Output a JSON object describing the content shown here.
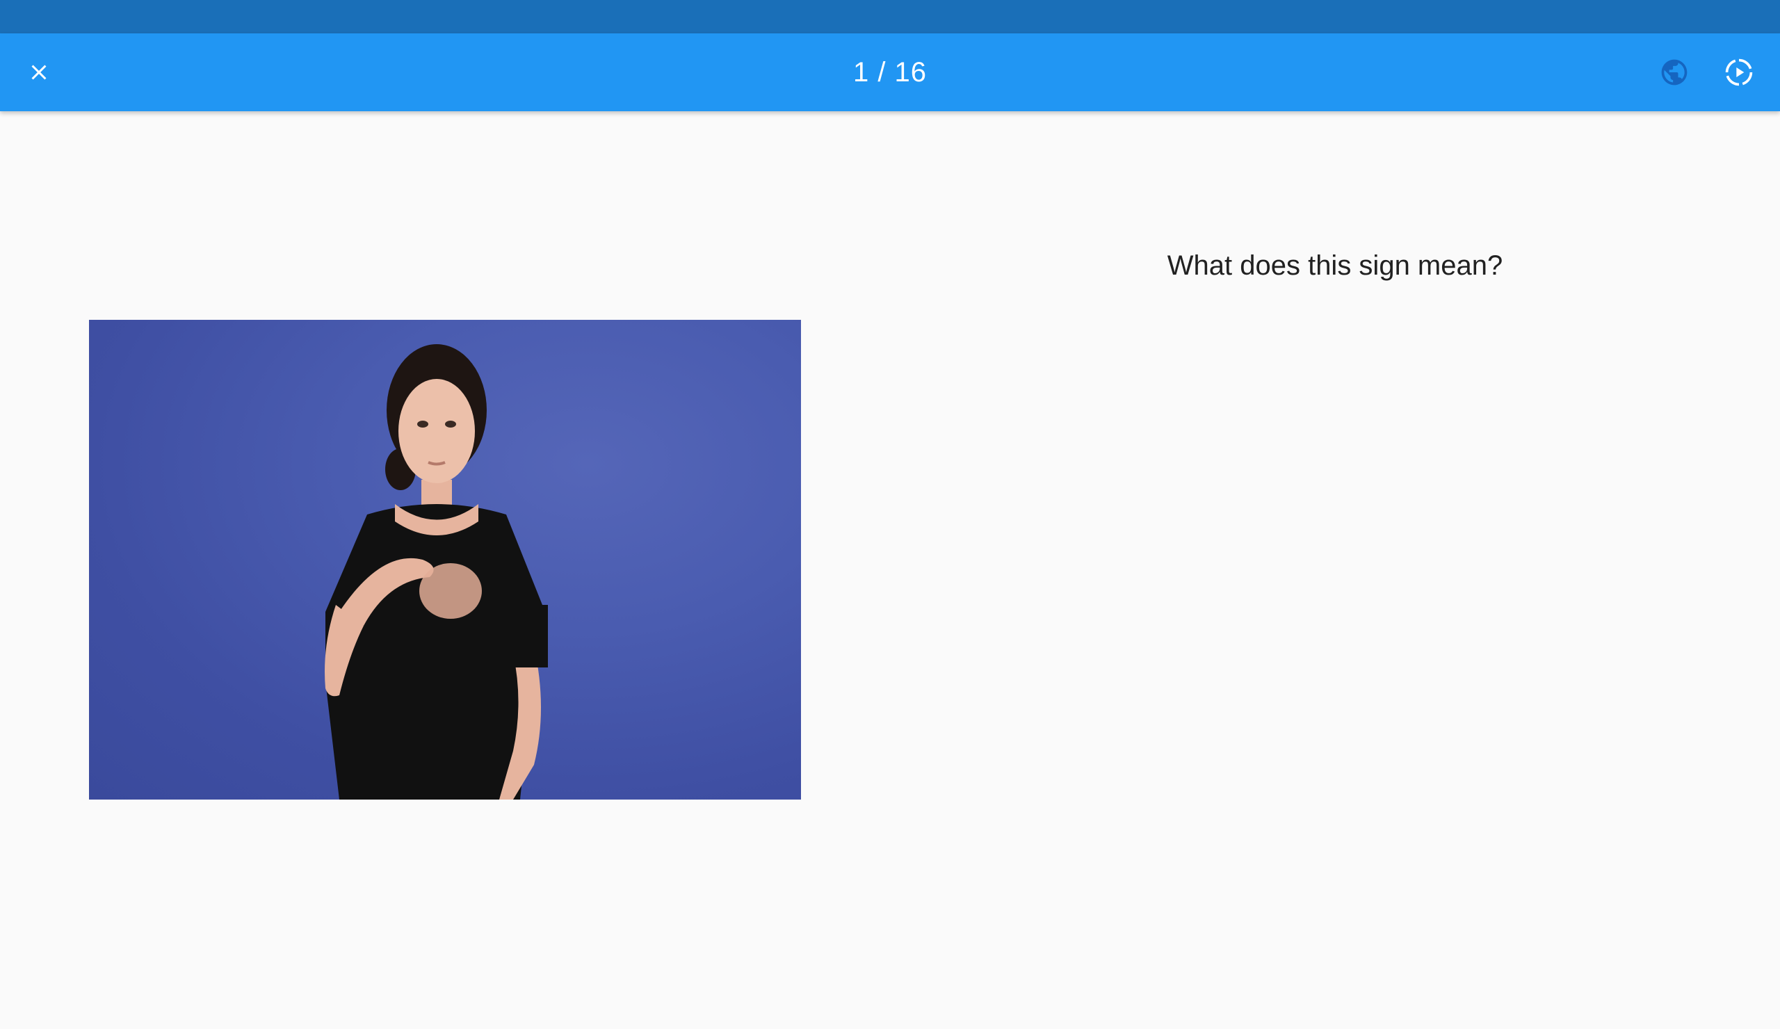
{
  "app_bar": {
    "progress": "1 / 16",
    "close_icon": "close-icon",
    "language_icon": "globe-icon",
    "autoplay_icon": "play-circle-dashed-icon"
  },
  "question": {
    "text": "What does this sign mean?"
  },
  "colors": {
    "status_bar": "#1a6fb8",
    "app_bar": "#2196f3",
    "background": "#fafafa",
    "video_backdrop": "#4656a8"
  }
}
